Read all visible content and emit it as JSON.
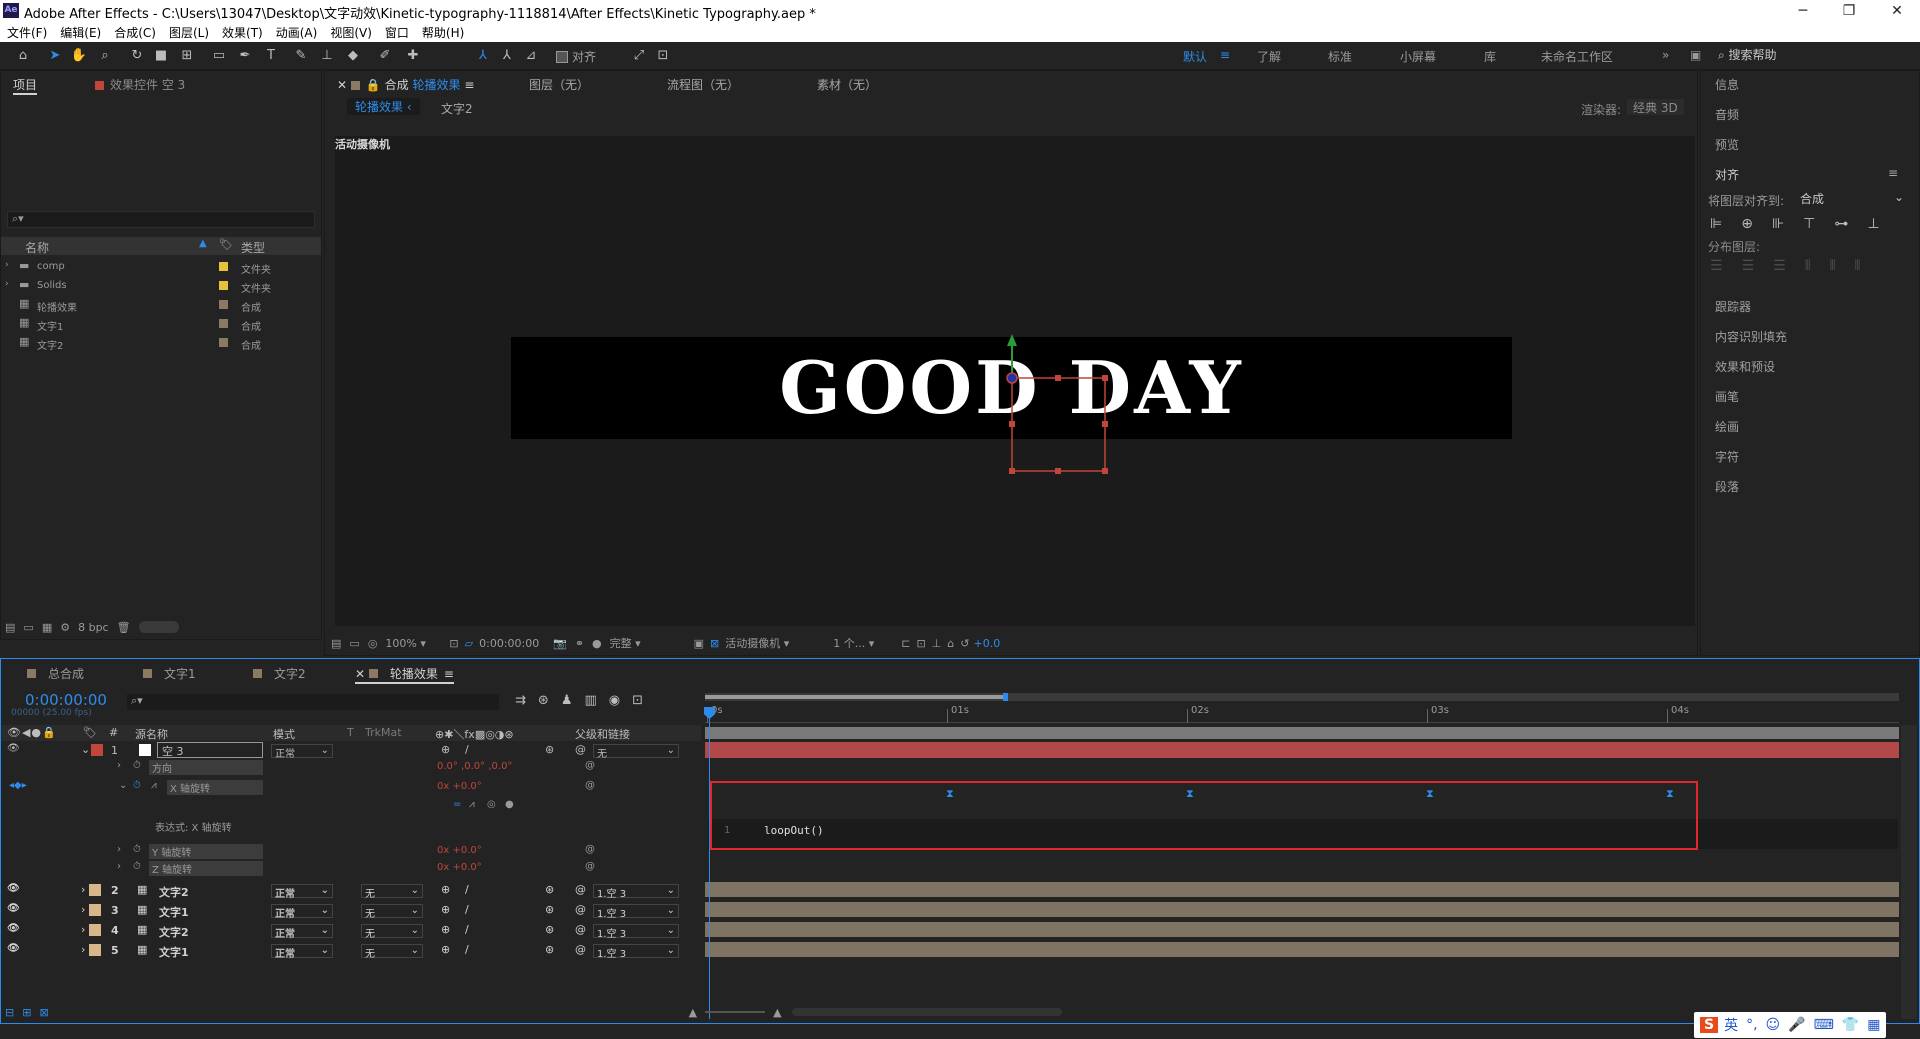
{
  "app": {
    "logo": "Ae",
    "title": "Adobe After Effects - C:\\Users\\13047\\Desktop\\文字动效\\Kinetic-typography-1118814\\After Effects\\Kinetic Typography.aep *",
    "min": "─",
    "max": "❐",
    "close": "✕"
  },
  "menu": [
    "文件(F)",
    "编辑(E)",
    "合成(C)",
    "图层(L)",
    "效果(T)",
    "动画(A)",
    "视图(V)",
    "窗口",
    "帮助(H)"
  ],
  "toolbar": {
    "align_label": "对齐"
  },
  "workspaces": {
    "default": "默认",
    "learn": "了解",
    "standard": "标准",
    "small": "小屏幕",
    "library": "库",
    "untitled": "未命名工作区",
    "more": "»",
    "search_placeholder": "搜索帮助"
  },
  "project": {
    "tab": "项目",
    "effects_tab": "效果控件 空 3",
    "col_name": "名称",
    "col_type": "类型",
    "bpc": "8 bpc",
    "items": [
      {
        "name": "comp",
        "type": "文件夹",
        "folder": true,
        "color": "#e8c23a"
      },
      {
        "name": "Solids",
        "type": "文件夹",
        "folder": true,
        "color": "#e8c23a"
      },
      {
        "name": "轮播效果",
        "type": "合成",
        "folder": false,
        "color": "#8a7a64"
      },
      {
        "name": "文字1",
        "type": "合成",
        "folder": false,
        "color": "#8a7a64"
      },
      {
        "name": "文字2",
        "type": "合成",
        "folder": false,
        "color": "#8a7a64"
      }
    ]
  },
  "viewer": {
    "comp_tab_prefix": "合成",
    "comp_name": "轮播效果",
    "layer_tab": "图层（无）",
    "flow_tab": "流程图（无）",
    "footage_tab": "素材（无）",
    "crumb_active": "轮播效果",
    "crumb_next": "文字2",
    "renderer_label": "渲染器:",
    "renderer": "经典 3D",
    "camera_label": "活动摄像机",
    "canvas_text": "GOOD DAY",
    "zoom": "100%",
    "timecode": "0:00:00:00",
    "quality": "完整",
    "camera_select": "活动摄像机",
    "views": "1 个...",
    "exposure": "+0.0"
  },
  "right_panel": {
    "info": "信息",
    "audio": "音频",
    "preview": "预览",
    "align": "对齐",
    "align_to_label": "将图层对齐到:",
    "align_to_value": "合成",
    "distribute": "分布图层:",
    "tracker": "跟踪器",
    "content_fill": "内容识别填充",
    "effects_presets": "效果和预设",
    "brushes": "画笔",
    "paint": "绘画",
    "character": "字符",
    "paragraph": "段落"
  },
  "timeline": {
    "tabs": [
      "总合成",
      "文字1",
      "文字2",
      "轮播效果"
    ],
    "tab_colors": [
      "#8a7a64",
      "#8a7a64",
      "#8a7a64",
      "#8a7a64"
    ],
    "timecode": "0:00:00:00",
    "timecode_sub": "00000 (25.00 fps)",
    "col_source": "源名称",
    "col_mode": "模式",
    "col_t": "T",
    "col_trkmat": "TrkMat",
    "col_parent": "父级和链接",
    "time_marks": [
      "0s",
      "01s",
      "02s",
      "03s",
      "04s"
    ],
    "layer1": {
      "num": "1",
      "name": "空 3",
      "mode": "正常",
      "parent": "无"
    },
    "props": [
      {
        "name": "方向",
        "value": "0.0° ,0.0° ,0.0°"
      },
      {
        "name": "X 轴旋转",
        "value": "0x +0.0°"
      },
      {
        "name": "Y 轴旋转",
        "value": "0x +0.0°"
      },
      {
        "name": "Z 轴旋转",
        "value": "0x +0.0°"
      }
    ],
    "expr_label": "表达式: X 轴旋转",
    "expr_line": "1",
    "expression": "loopOut()",
    "layers": [
      {
        "num": "2",
        "name": "文字2",
        "mode": "正常",
        "trk": "无",
        "parent": "1.空 3"
      },
      {
        "num": "3",
        "name": "文字1",
        "mode": "正常",
        "trk": "无",
        "parent": "1.空 3"
      },
      {
        "num": "4",
        "name": "文字2",
        "mode": "正常",
        "trk": "无",
        "parent": "1.空 3"
      },
      {
        "num": "5",
        "name": "文字1",
        "mode": "正常",
        "trk": "无",
        "parent": "1.空 3"
      }
    ]
  },
  "ime": {
    "s": "S",
    "lang": "英"
  }
}
